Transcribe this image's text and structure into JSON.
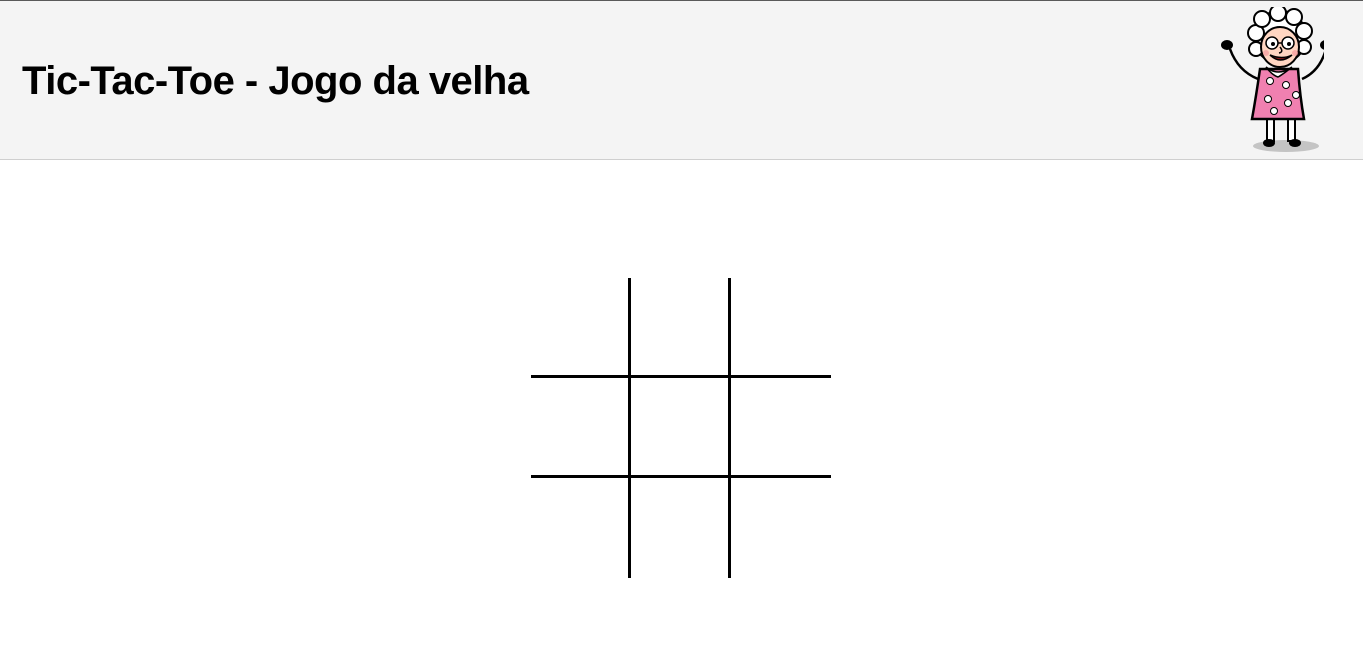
{
  "header": {
    "title": "Tic-Tac-Toe - Jogo da velha",
    "mascot_icon": "grandma-cartoon-icon",
    "background_color": "#f4f4f4"
  },
  "board": {
    "line_color": "#000000",
    "cells": [
      "",
      "",
      "",
      "",
      "",
      "",
      "",
      "",
      ""
    ]
  }
}
